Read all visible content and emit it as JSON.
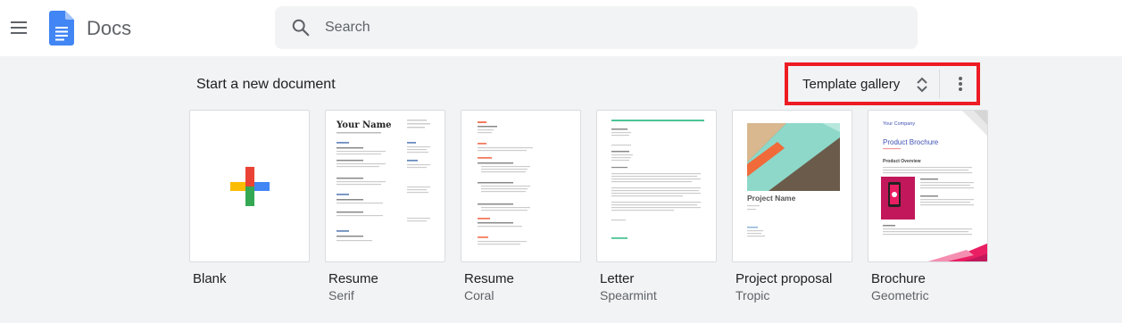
{
  "header": {
    "app_name": "Docs",
    "search": {
      "placeholder": "Search",
      "value": ""
    },
    "icons": [
      "menu-icon",
      "docs-logo-icon",
      "search-icon"
    ]
  },
  "section": {
    "title": "Start a new document",
    "gallery_label": "Template gallery",
    "icons": [
      "unfold-more-icon",
      "more-vert-icon"
    ]
  },
  "templates": [
    {
      "name": "Blank",
      "subtitle": ""
    },
    {
      "name": "Resume",
      "subtitle": "Serif"
    },
    {
      "name": "Resume",
      "subtitle": "Coral"
    },
    {
      "name": "Letter",
      "subtitle": "Spearmint"
    },
    {
      "name": "Project proposal",
      "subtitle": "Tropic"
    },
    {
      "name": "Brochure",
      "subtitle": "Geometric"
    }
  ],
  "thumbnails": {
    "serif": {
      "heading": "Your Name"
    },
    "tropic": {
      "heading": "Project Name"
    },
    "geometric": {
      "company": "Your Company",
      "heading": "Product Brochure",
      "overview": "Product Overview"
    }
  },
  "colors": {
    "highlight_border": "#ed1c24",
    "docs_blue": "#4285f4",
    "google_red": "#ea4335",
    "google_yellow": "#fbbc04",
    "google_green": "#34a853",
    "coral": "#f37c5f",
    "spearmint": "#4dc495",
    "tropic_teal": "#8dd8c9",
    "brochure_accent": "#3f51b5"
  }
}
